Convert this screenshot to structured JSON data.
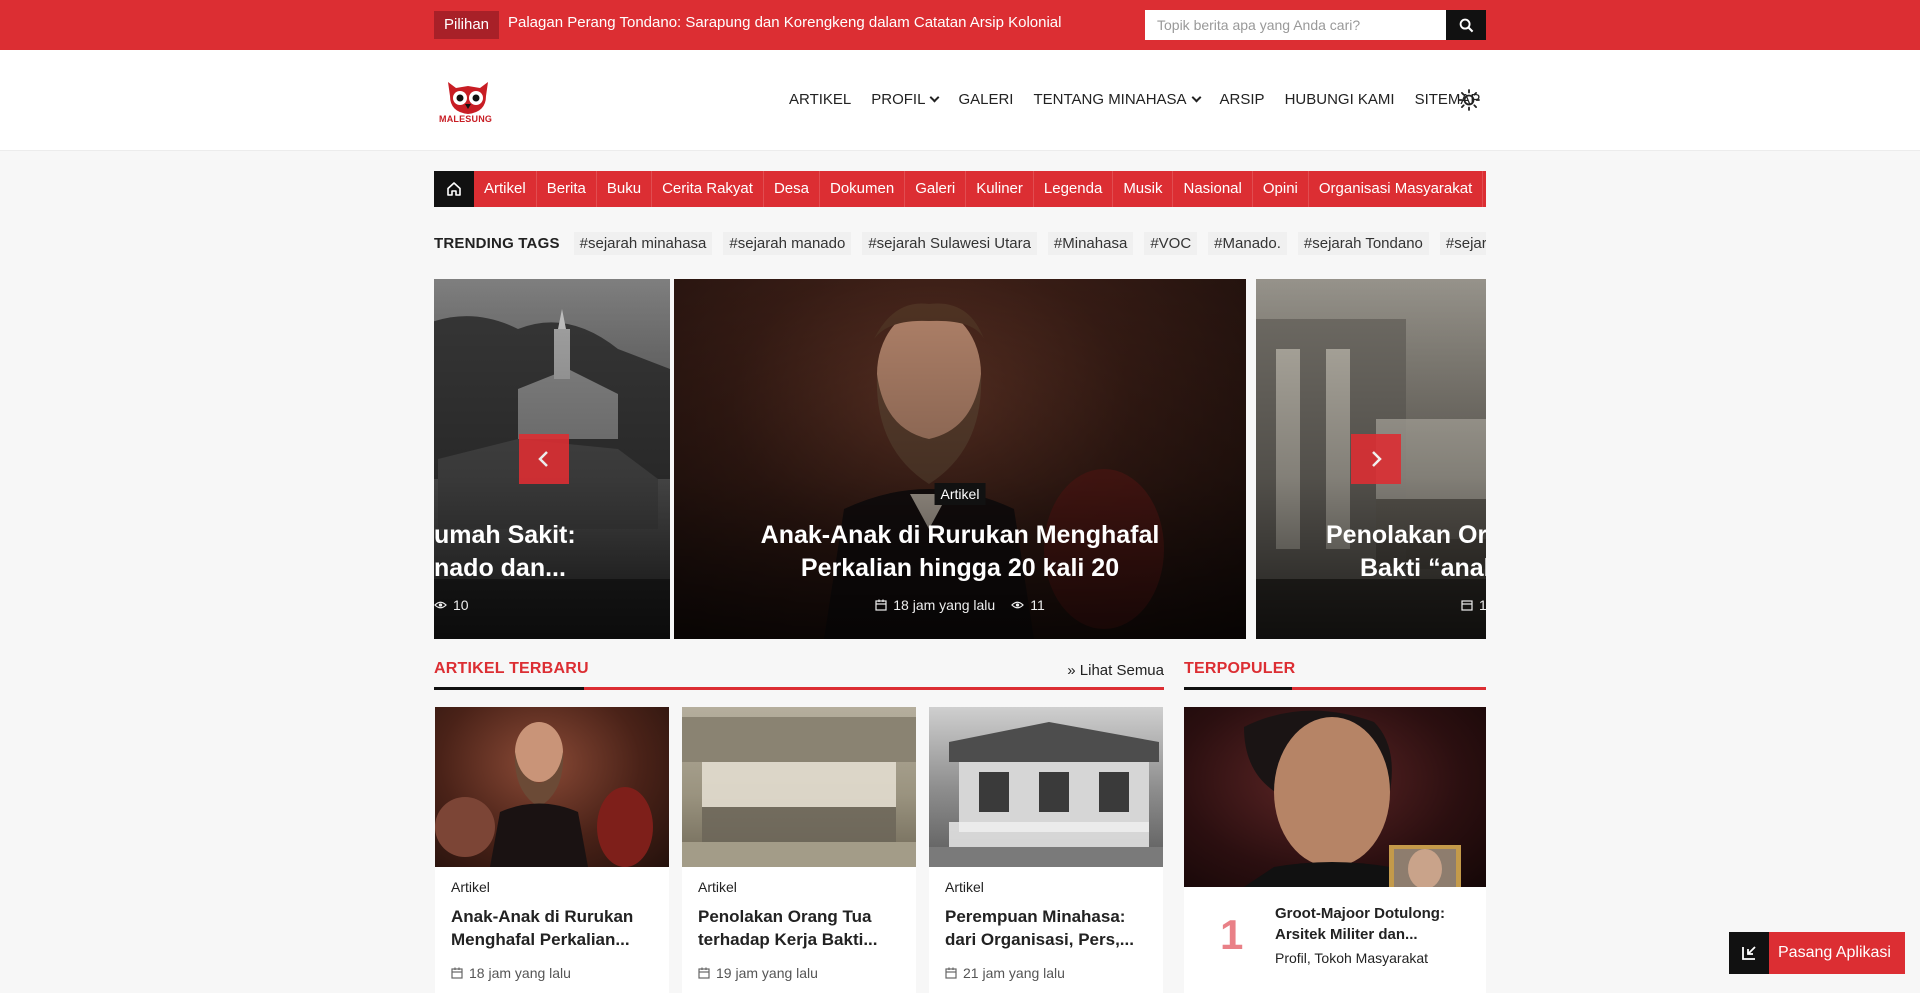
{
  "topbar": {
    "badge": "Pilihan",
    "headline": "Palagan Perang Tondano: Sarapung dan Korengkeng dalam Catatan Arsip Kolonial",
    "search_placeholder": "Topik berita apa yang Anda cari?",
    "search_icon": "search-icon"
  },
  "logo": {
    "text": "MALESUNG",
    "icon": "owl-logo"
  },
  "nav": {
    "items": [
      "ARTIKEL",
      "PROFIL",
      "GALERI",
      "TENTANG MINAHASA",
      "ARSIP",
      "HUBUNGI KAMI",
      "SITEMAP"
    ],
    "theme_icon": "sun-icon"
  },
  "categories": [
    "Artikel",
    "Berita",
    "Buku",
    "Cerita Rakyat",
    "Desa",
    "Dokumen",
    "Galeri",
    "Kuliner",
    "Legenda",
    "Musik",
    "Nasional",
    "Opini",
    "Organisasi Masyarakat"
  ],
  "trending": {
    "title": "TRENDING TAGS",
    "tags": [
      "#sejarah minahasa",
      "#sejarah manado",
      "#sejarah Sulawesi Utara",
      "#Minahasa",
      "#VOC",
      "#Manado.",
      "#sejarah Tondano",
      "#sejarah"
    ]
  },
  "slider": {
    "left": {
      "title_line1": "umah Sakit:",
      "title_line2": "nado dan...",
      "views": "10"
    },
    "center": {
      "category": "Artikel",
      "title": "Anak-Anak di Rurukan Menghafal Perkalian hingga 20 kali 20",
      "time": "18 jam yang lalu",
      "views": "11"
    },
    "right": {
      "title_line1": "Penolakan Or",
      "title_line2": "Bakti “anal",
      "time": "1"
    }
  },
  "latest": {
    "title": "ARTIKEL TERBARU",
    "see_all": "» Lihat Semua",
    "cards": [
      {
        "category": "Artikel",
        "title": "Anak-Anak di Rurukan Menghafal Perkalian...",
        "time": "18 jam yang lalu"
      },
      {
        "category": "Artikel",
        "title": "Penolakan Orang Tua terhadap Kerja Bakti...",
        "time": "19 jam yang lalu"
      },
      {
        "category": "Artikel",
        "title": "Perempuan Minahasa: dari Organisasi, Pers,...",
        "time": "21 jam yang lalu"
      }
    ]
  },
  "popular": {
    "title": "TERPOPULER",
    "item": {
      "rank": "1",
      "title": "Groot-Majoor Dotulong: Arsitek Militer dan...",
      "categories": "Profil, Tokoh Masyarakat"
    }
  },
  "install": {
    "label": "Pasang Aplikasi",
    "icon": "install-icon"
  },
  "colors": {
    "brand_red": "#dc2e33",
    "dark": "#111111"
  }
}
